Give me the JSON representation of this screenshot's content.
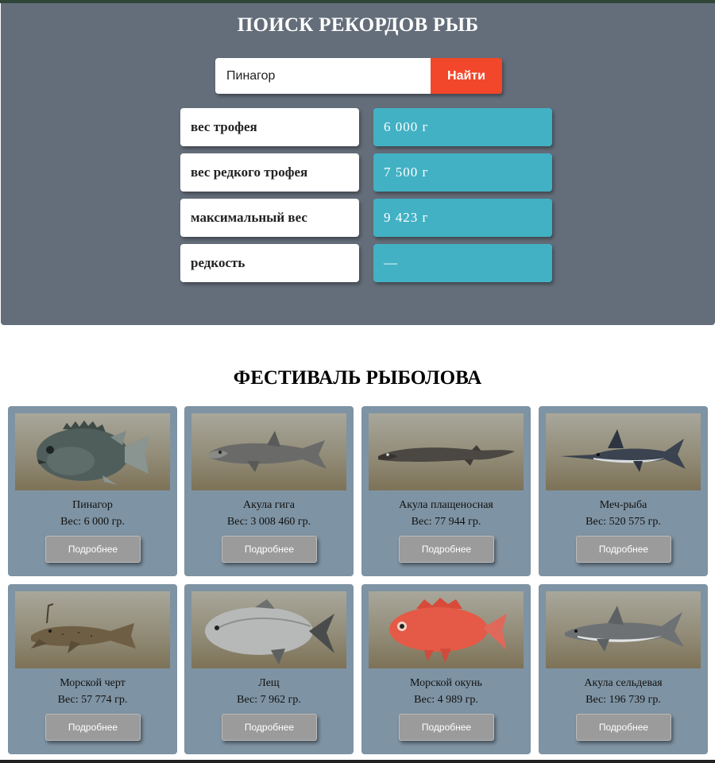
{
  "search": {
    "title": "ПОИСК РЕКОРДОВ РЫБ",
    "value": "Пинагор",
    "button_label": "Найти"
  },
  "stats": [
    {
      "label": "вес трофея",
      "value": "6 000 г"
    },
    {
      "label": "вес редкого трофея",
      "value": "7 500 г"
    },
    {
      "label": "максимальный вес",
      "value": "9 423 г"
    },
    {
      "label": "редкость",
      "value": "—"
    }
  ],
  "festival": {
    "title": "ФЕСТИВАЛЬ РЫБОЛОВА",
    "cards": [
      {
        "name": "Пинагор",
        "weight": "Вес: 6 000 гр.",
        "button": "Подробнее",
        "icon": "lumpfish-image"
      },
      {
        "name": "Акула гига",
        "weight": "Вес: 3 008 460 гр.",
        "button": "Подробнее",
        "icon": "basking-shark-image"
      },
      {
        "name": "Акула плащеносная",
        "weight": "Вес: 77 944 гр.",
        "button": "Подробнее",
        "icon": "frilled-shark-image"
      },
      {
        "name": "Меч-рыба",
        "weight": "Вес: 520 575 гр.",
        "button": "Подробнее",
        "icon": "swordfish-image"
      },
      {
        "name": "Морской черт",
        "weight": "Вес: 57 774 гр.",
        "button": "Подробнее",
        "icon": "anglerfish-image"
      },
      {
        "name": "Лещ",
        "weight": "Вес: 7 962 гр.",
        "button": "Подробнее",
        "icon": "bream-image"
      },
      {
        "name": "Морской окунь",
        "weight": "Вес: 4 989 гр.",
        "button": "Подробнее",
        "icon": "redfish-image"
      },
      {
        "name": "Акула сельдевая",
        "weight": "Вес: 196 739 гр.",
        "button": "Подробнее",
        "icon": "porbeagle-shark-image"
      }
    ]
  },
  "colors": {
    "panel": "#646e7a",
    "search_button": "#f2472a",
    "stat_value": "#42b1c4",
    "card": "#7e93a3"
  }
}
